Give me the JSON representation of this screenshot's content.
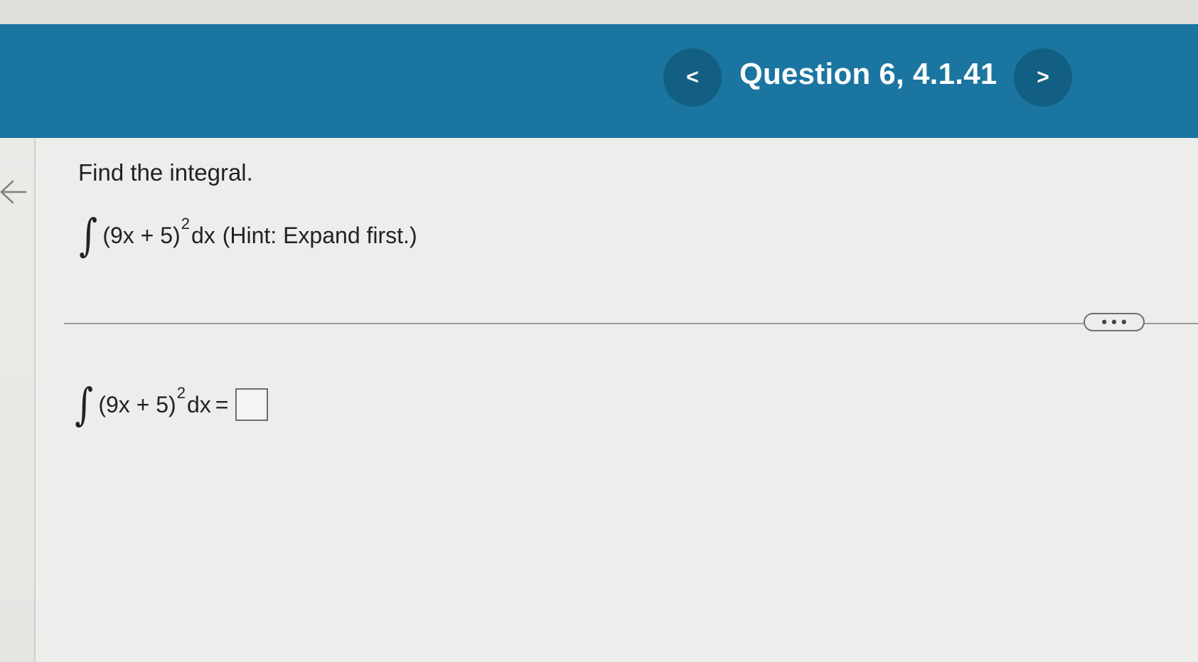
{
  "header": {
    "title": "Question 6, 4.1.41",
    "prev_icon": "chevron-left-icon",
    "next_icon": "chevron-right-icon",
    "prev_glyph": "<",
    "next_glyph": ">"
  },
  "sidebar": {
    "back_icon": "arrow-left-icon"
  },
  "question": {
    "instruction": "Find the integral.",
    "integral_symbol": "∫",
    "integrand": "(9x + 5)",
    "exponent": "2",
    "differential": "dx",
    "hint": "(Hint: Expand first.)"
  },
  "answer": {
    "integral_symbol": "∫",
    "integrand": "(9x + 5)",
    "exponent": "2",
    "differential": "dx",
    "equals": "=",
    "value": ""
  },
  "more_button": {
    "label": "• • •"
  },
  "colors": {
    "header_bg": "#1a75a0",
    "nav_button_bg": "#135f83",
    "page_bg": "#ededeb",
    "text": "#222222"
  }
}
